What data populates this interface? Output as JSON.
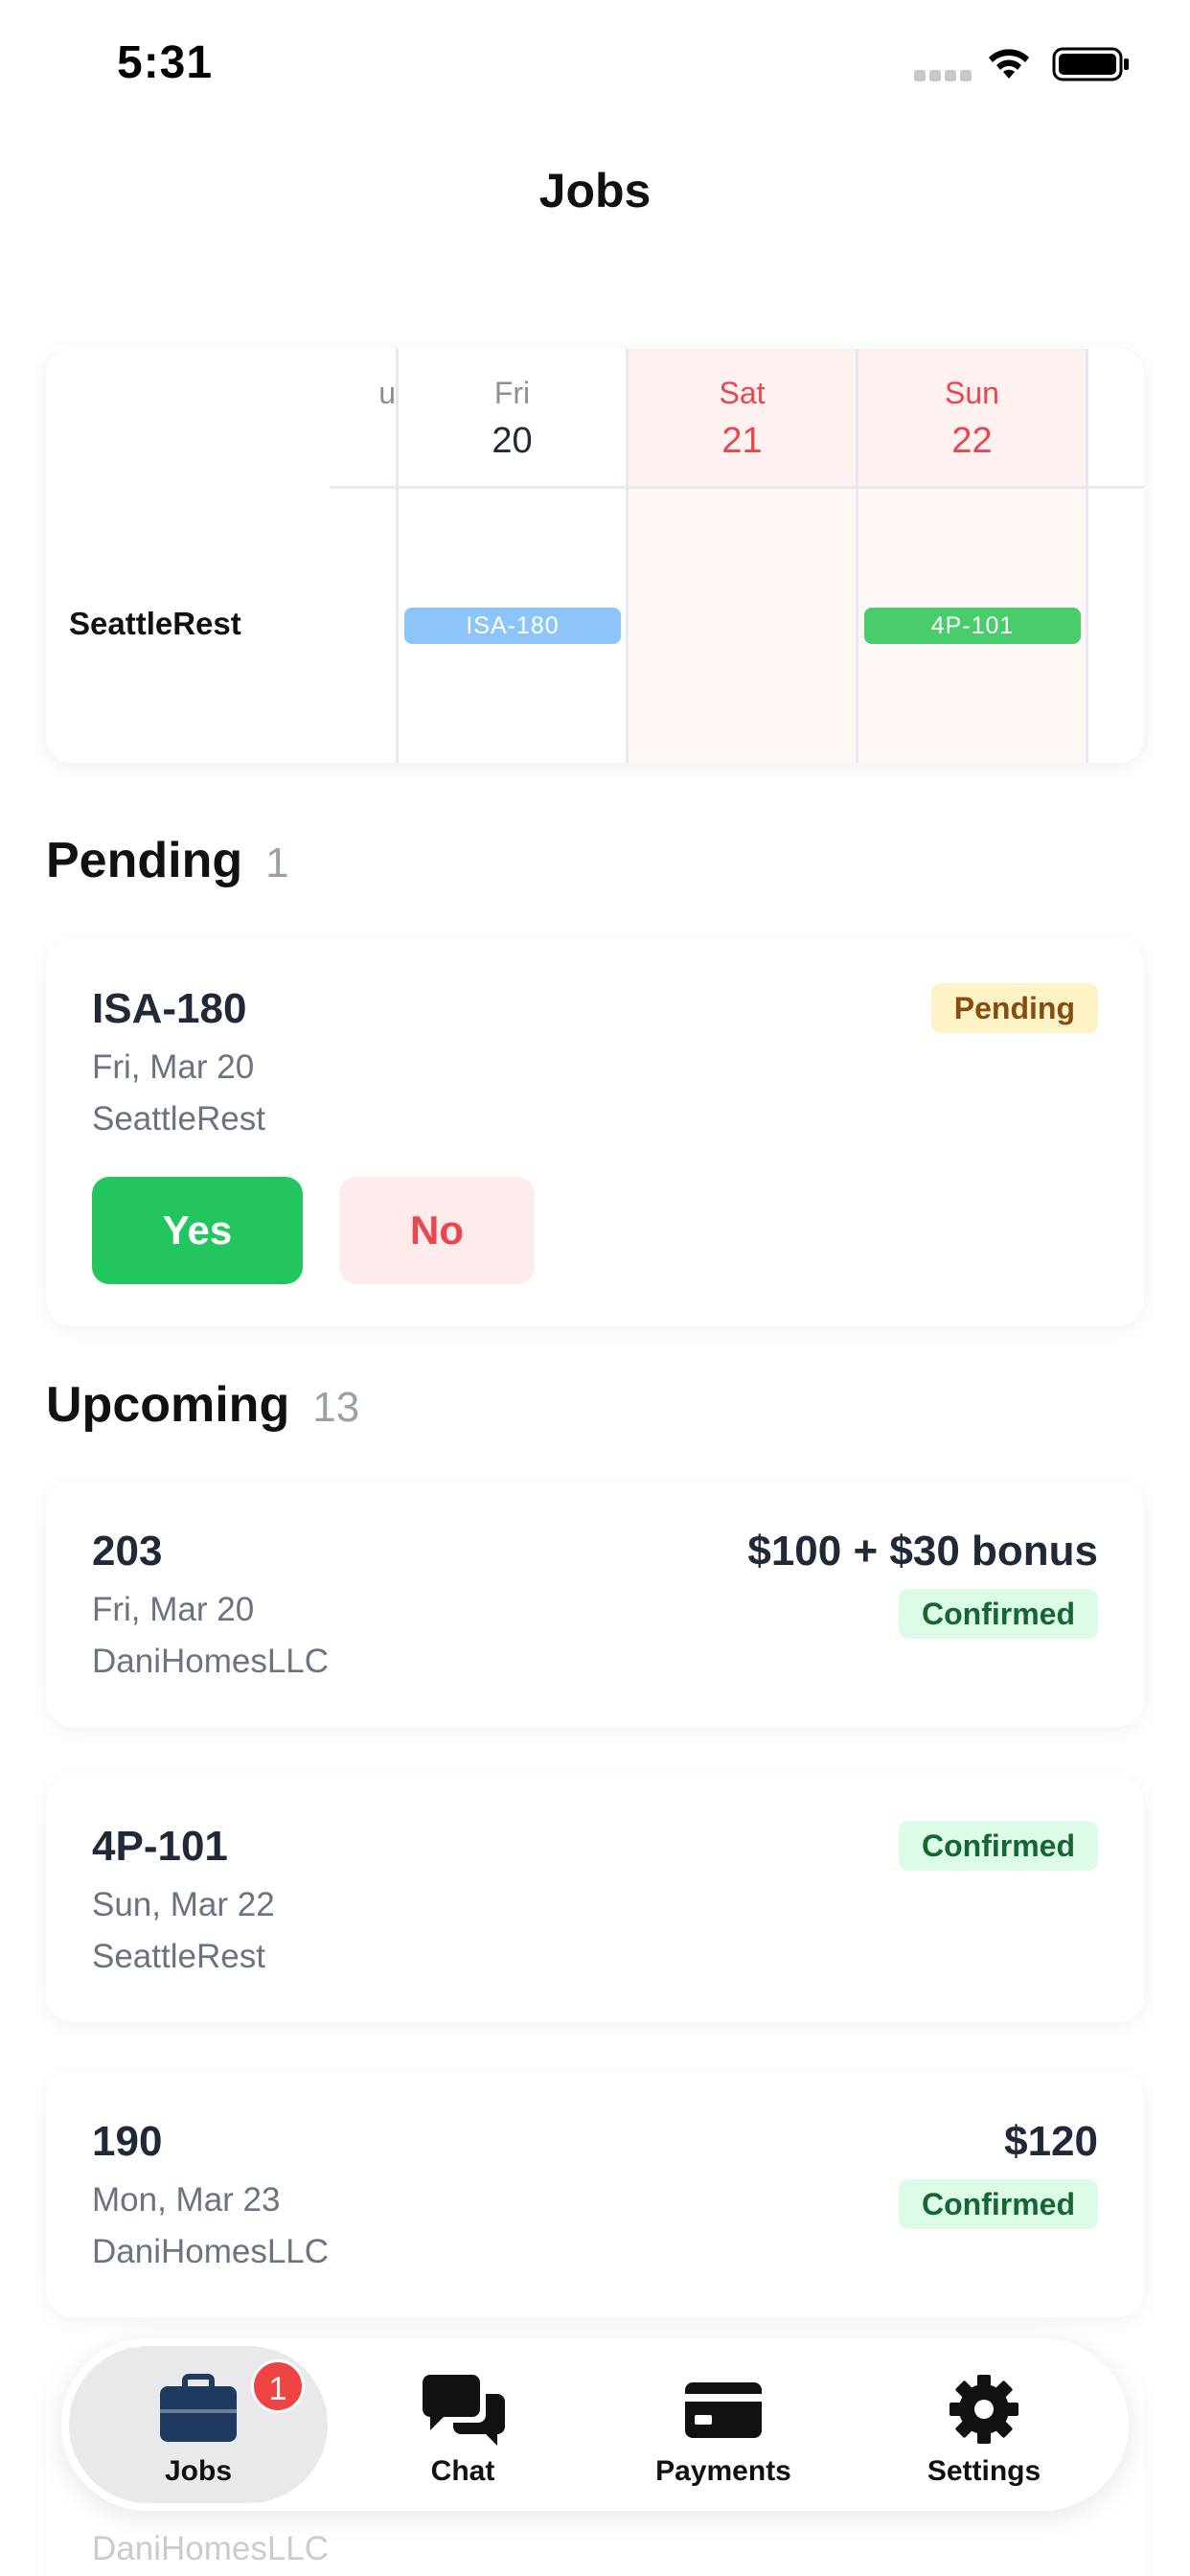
{
  "status_bar": {
    "time": "5:31"
  },
  "header": {
    "title": "Jobs"
  },
  "calendar": {
    "row_label": "SeattleRest",
    "days": [
      {
        "name": "u",
        "num": ""
      },
      {
        "name": "Fri",
        "num": "20",
        "chip": "ISA-180"
      },
      {
        "name": "Sat",
        "num": "21"
      },
      {
        "name": "Sun",
        "num": "22",
        "chip": "4P-101"
      }
    ]
  },
  "pending": {
    "title": "Pending",
    "count": "1",
    "job": {
      "id": "ISA-180",
      "date": "Fri, Mar 20",
      "client": "SeattleRest",
      "status": "Pending",
      "yes_label": "Yes",
      "no_label": "No"
    }
  },
  "upcoming": {
    "title": "Upcoming",
    "count": "13",
    "jobs": [
      {
        "id": "203",
        "date": "Fri, Mar 20",
        "client": "DaniHomesLLC",
        "price": "$100 + $30 bonus",
        "status": "Confirmed"
      },
      {
        "id": "4P-101",
        "date": "Sun, Mar 22",
        "client": "SeattleRest",
        "price": "",
        "status": "Confirmed"
      },
      {
        "id": "190",
        "date": "Mon, Mar 23",
        "client": "DaniHomesLLC",
        "price": "$120",
        "status": "Confirmed"
      }
    ],
    "partial_client": "DaniHomesLLC"
  },
  "tabbar": {
    "tabs": [
      {
        "label": "Jobs",
        "icon": "briefcase-icon",
        "badge": "1"
      },
      {
        "label": "Chat",
        "icon": "chat-bubbles-icon"
      },
      {
        "label": "Payments",
        "icon": "credit-card-icon"
      },
      {
        "label": "Settings",
        "icon": "gear-icon"
      }
    ]
  },
  "colors": {
    "accent_green": "#22c55e",
    "chip_blue": "#8ec5f8",
    "weekend_red": "#e5484d",
    "badge_red": "#ef4444"
  }
}
